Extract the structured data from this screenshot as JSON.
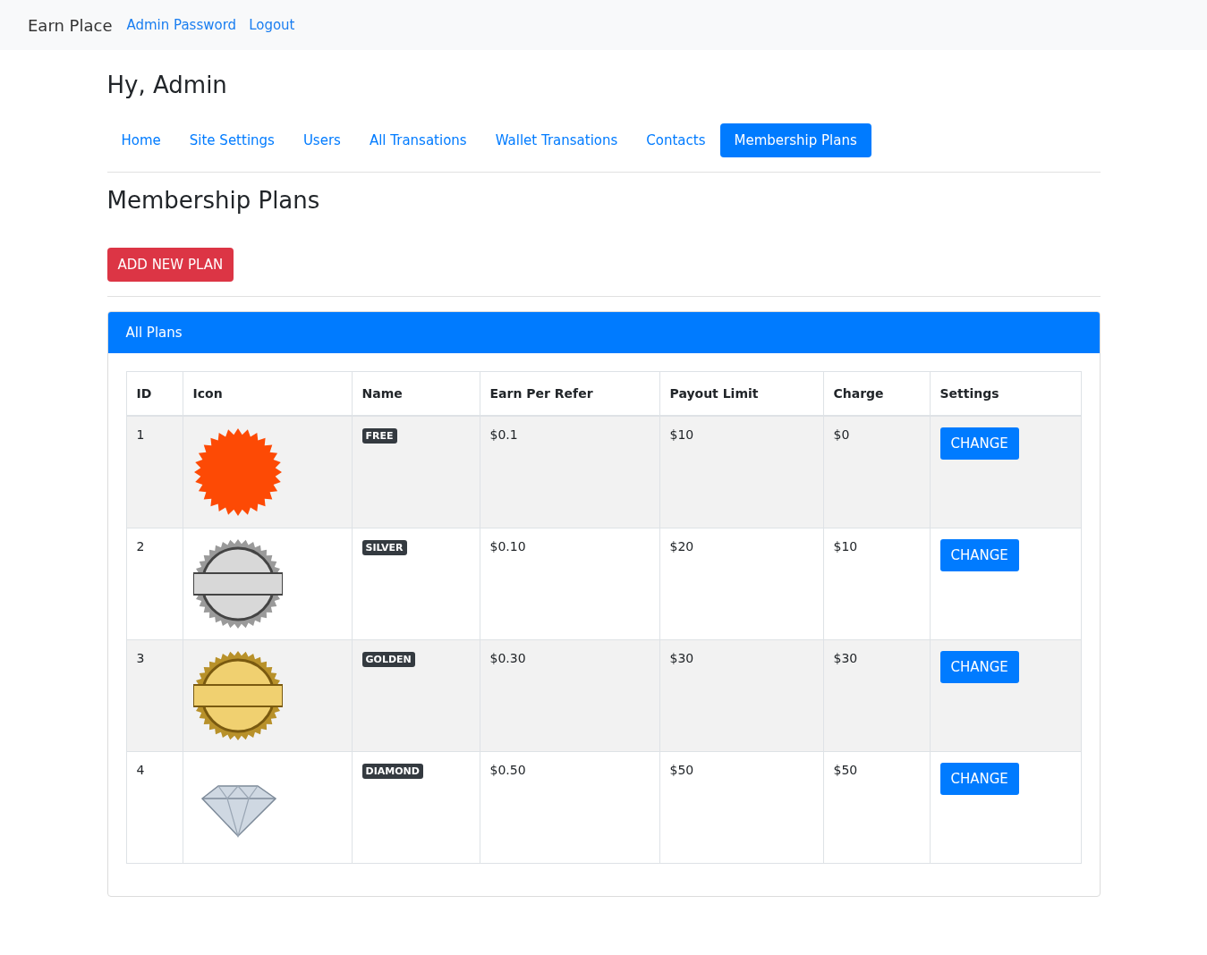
{
  "navbar": {
    "brand": "Earn Place",
    "links": [
      "Admin Password",
      "Logout"
    ]
  },
  "greeting": "Hy, Admin",
  "tabs": [
    {
      "label": "Home",
      "selected": false
    },
    {
      "label": "Site Settings",
      "selected": false
    },
    {
      "label": "Users",
      "selected": false
    },
    {
      "label": "All Transations",
      "selected": false
    },
    {
      "label": "Wallet Transations",
      "selected": false
    },
    {
      "label": "Contacts",
      "selected": false
    },
    {
      "label": "Membership Plans",
      "selected": true
    }
  ],
  "page_title": "Membership Plans",
  "add_button": "ADD NEW PLAN",
  "card": {
    "title": "All Plans",
    "table": {
      "columns": [
        "ID",
        "Icon",
        "Name",
        "Earn Per Refer",
        "Payout Limit",
        "Charge",
        "Settings"
      ],
      "rows": [
        {
          "id": "1",
          "kind": "starburst",
          "name": "FREE",
          "earn": "$0.1",
          "payout": "$10",
          "charge": "$0",
          "button": "CHANGE"
        },
        {
          "id": "2",
          "kind": "silver-seal",
          "name": "SILVER",
          "earn": "$0.10",
          "payout": "$20",
          "charge": "$10",
          "button": "CHANGE"
        },
        {
          "id": "3",
          "kind": "gold-seal",
          "name": "GOLDEN",
          "earn": "$0.30",
          "payout": "$30",
          "charge": "$30",
          "button": "CHANGE"
        },
        {
          "id": "4",
          "kind": "diamond",
          "name": "DIAMOND",
          "earn": "$0.50",
          "payout": "$50",
          "charge": "$50",
          "button": "CHANGE"
        }
      ]
    }
  }
}
